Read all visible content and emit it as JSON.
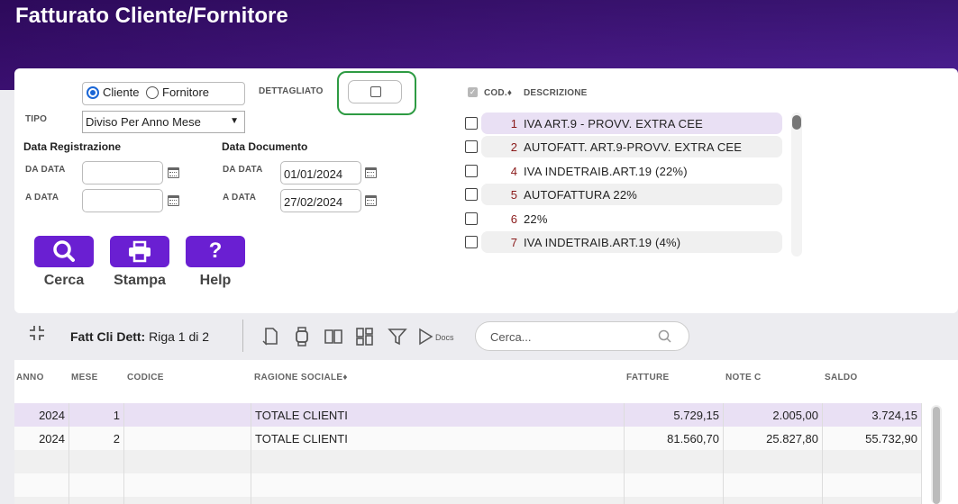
{
  "title": "Fatturato Cliente/Fornitore",
  "form": {
    "radio_cliente": "Cliente",
    "radio_fornitore": "Fornitore",
    "dettagliato_label": "DETTAGLIATO",
    "tipo_label": "TIPO",
    "tipo_value": "Diviso Per Anno Mese",
    "data_registrazione": "Data Registrazione",
    "data_documento": "Data Documento",
    "da_data": "DA DATA",
    "a_data": "A DATA",
    "reg_da": "",
    "reg_a": "",
    "doc_da": "01/01/2024",
    "doc_a": "27/02/2024"
  },
  "buttons": {
    "cerca": "Cerca",
    "stampa": "Stampa",
    "help": "Help"
  },
  "code_list": {
    "col_code": "COD.",
    "col_desc": "DESCRIZIONE",
    "items": [
      {
        "code": "1",
        "desc": "IVA ART.9 - PROVV. EXTRA CEE"
      },
      {
        "code": "2",
        "desc": "AUTOFATT. ART.9-PROVV. EXTRA CEE"
      },
      {
        "code": "4",
        "desc": "IVA INDETRAIB.ART.19 (22%)"
      },
      {
        "code": "5",
        "desc": "AUTOFATTURA 22%"
      },
      {
        "code": "6",
        "desc": "22%"
      },
      {
        "code": "7",
        "desc": "IVA INDETRAIB.ART.19 (4%)"
      }
    ]
  },
  "toolbar": {
    "grid_name": "Fatt Cli Dett:",
    "row_info": "Riga 1 di 2",
    "docs_label": "Docs",
    "search_placeholder": "Cerca..."
  },
  "table": {
    "headers": {
      "anno": "ANNO",
      "mese": "MESE",
      "codice": "CODICE",
      "ragione": "RAGIONE SOCIALE",
      "fatture": "FATTURE",
      "note": "NOTE C",
      "saldo": "SALDO"
    },
    "rows": [
      {
        "anno": "2024",
        "mese": "1",
        "codice": "",
        "ragione": "TOTALE CLIENTI",
        "fatture": "5.729,15",
        "note": "2.005,00",
        "saldo": "3.724,15"
      },
      {
        "anno": "2024",
        "mese": "2",
        "codice": "",
        "ragione": "TOTALE CLIENTI",
        "fatture": "81.560,70",
        "note": "25.827,80",
        "saldo": "55.732,90"
      }
    ]
  },
  "colors": {
    "accent": "#6a1fd2",
    "header_bg": "#3a0f70",
    "selected_row": "#e9e0f4",
    "highlight_outline": "#2e9b43"
  }
}
